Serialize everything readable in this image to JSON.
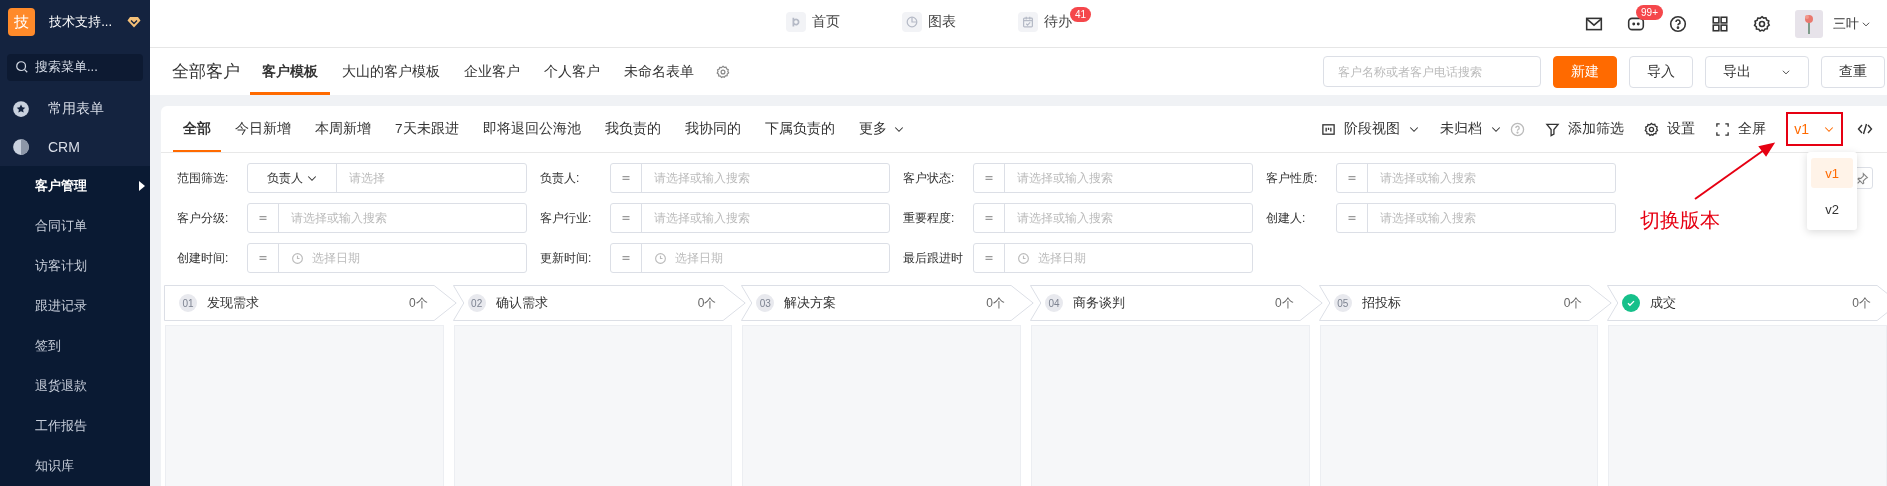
{
  "sidebar": {
    "org": {
      "logo": "技",
      "name": "技术支持..."
    },
    "search": {
      "placeholder": "搜索菜单..."
    },
    "items": [
      {
        "label": "常用表单",
        "expanded": false
      },
      {
        "label": "CRM",
        "expanded": true,
        "children": [
          {
            "label": "客户管理",
            "selected": true
          },
          {
            "label": "合同订单",
            "selected": false
          },
          {
            "label": "访客计划",
            "selected": false
          },
          {
            "label": "跟进记录",
            "selected": false
          },
          {
            "label": "签到",
            "selected": false
          },
          {
            "label": "退货退款",
            "selected": false
          },
          {
            "label": "工作报告",
            "selected": false
          },
          {
            "label": "知识库",
            "selected": false
          }
        ]
      }
    ]
  },
  "top_nav": {
    "items": [
      {
        "label": "首页"
      },
      {
        "label": "图表"
      },
      {
        "label": "待办",
        "badge": "41"
      }
    ],
    "message_badge": "99+",
    "user": "三叶"
  },
  "page_header": {
    "title": "全部客户",
    "tabs": [
      {
        "label": "客户模板",
        "selected": true
      },
      {
        "label": "大山的客户模板",
        "selected": false
      },
      {
        "label": "企业客户",
        "selected": false
      },
      {
        "label": "个人客户",
        "selected": false
      },
      {
        "label": "未命名表单",
        "selected": false
      }
    ],
    "search": {
      "placeholder": "客户名称或者客户电话搜索"
    },
    "buttons": [
      {
        "label": "新建",
        "kind": "primary"
      },
      {
        "label": "导入",
        "kind": "plain"
      },
      {
        "label": "导出",
        "kind": "dropdown"
      },
      {
        "label": "查重",
        "kind": "plain"
      }
    ]
  },
  "filter_tabs": [
    {
      "label": "全部",
      "selected": true
    },
    {
      "label": "今日新增",
      "selected": false
    },
    {
      "label": "本周新增",
      "selected": false
    },
    {
      "label": "7天未跟进",
      "selected": false
    },
    {
      "label": "即将退回公海池",
      "selected": false
    },
    {
      "label": "我负责的",
      "selected": false
    },
    {
      "label": "我协同的",
      "selected": false
    },
    {
      "label": "下属负责的",
      "selected": false
    },
    {
      "label": "更多",
      "selected": false
    }
  ],
  "toolbar": {
    "view": "阶段视图",
    "archive": "未归档",
    "add_filter": "添加筛选",
    "settings": "设置",
    "fullscreen": "全屏",
    "version": "v1"
  },
  "version_menu": {
    "options": [
      {
        "label": "v1",
        "selected": true
      },
      {
        "label": "v2",
        "selected": false
      }
    ]
  },
  "annotation": {
    "label": "切换版本"
  },
  "filters": [
    {
      "label": "范围筛选:",
      "kind": "scope",
      "scope": "负责人",
      "placeholder": "请选择"
    },
    {
      "label": "负责人:",
      "kind": "select",
      "placeholder": "请选择或输入搜索"
    },
    {
      "label": "客户状态:",
      "kind": "select",
      "placeholder": "请选择或输入搜索"
    },
    {
      "label": "客户性质:",
      "kind": "select",
      "placeholder": "请选择或输入搜索"
    },
    {
      "label": "客户分级:",
      "kind": "select",
      "placeholder": "请选择或输入搜索"
    },
    {
      "label": "客户行业:",
      "kind": "select",
      "placeholder": "请选择或输入搜索"
    },
    {
      "label": "重要程度:",
      "kind": "select",
      "placeholder": "请选择或输入搜索"
    },
    {
      "label": "创建人:",
      "kind": "select",
      "placeholder": "请选择或输入搜索"
    },
    {
      "label": "创建时间:",
      "kind": "date",
      "placeholder": "选择日期"
    },
    {
      "label": "更新时间:",
      "kind": "date",
      "placeholder": "选择日期"
    },
    {
      "label": "最后跟进时",
      "kind": "date",
      "placeholder": "选择日期"
    }
  ],
  "stages": [
    {
      "kind": "number",
      "number": "01",
      "name": "发现需求",
      "count": "0个"
    },
    {
      "kind": "number",
      "number": "02",
      "name": "确认需求",
      "count": "0个"
    },
    {
      "kind": "number",
      "number": "03",
      "name": "解决方案",
      "count": "0个"
    },
    {
      "kind": "number",
      "number": "04",
      "name": "商务谈判",
      "count": "0个"
    },
    {
      "kind": "number",
      "number": "05",
      "name": "招投标",
      "count": "0个"
    },
    {
      "kind": "done",
      "name": "成交",
      "count": "0个"
    }
  ]
}
